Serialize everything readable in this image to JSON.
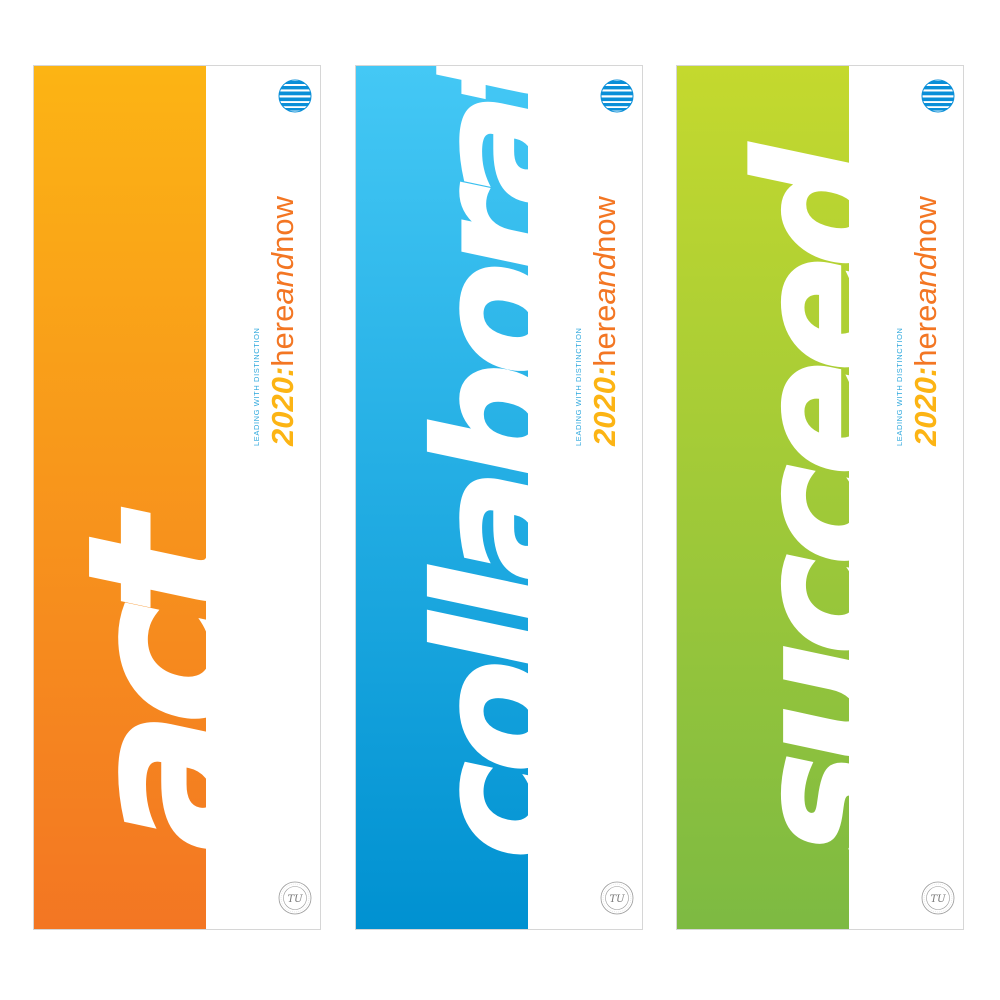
{
  "banners": [
    {
      "word": "act",
      "subtitle": "LEADING WITH DISTINCTION",
      "headline_year": "2020:",
      "headline_here": "here",
      "headline_and": "and",
      "headline_now": "now",
      "strip_color_top": "#fcb414",
      "strip_color_bottom": "#f37623"
    },
    {
      "word": "collaborate",
      "subtitle": "LEADING WITH DISTINCTION",
      "headline_year": "2020:",
      "headline_here": "here",
      "headline_and": "and",
      "headline_now": "now",
      "strip_color_top": "#44c8f5",
      "strip_color_bottom": "#0091d1"
    },
    {
      "word": "succeed",
      "subtitle": "LEADING WITH DISTINCTION",
      "headline_year": "2020:",
      "headline_here": "here",
      "headline_and": "and",
      "headline_now": "now",
      "strip_color_top": "#c4d92e",
      "strip_color_bottom": "#7dba42"
    }
  ],
  "logos": {
    "top_icon": "att-globe-icon",
    "bottom_icon": "university-seal-icon",
    "seal_text": "TU"
  },
  "colors": {
    "orange": "#f37623",
    "yellow": "#fcb414",
    "blue": "#2aa6dc",
    "globe_blue": "#0a8fd8"
  }
}
